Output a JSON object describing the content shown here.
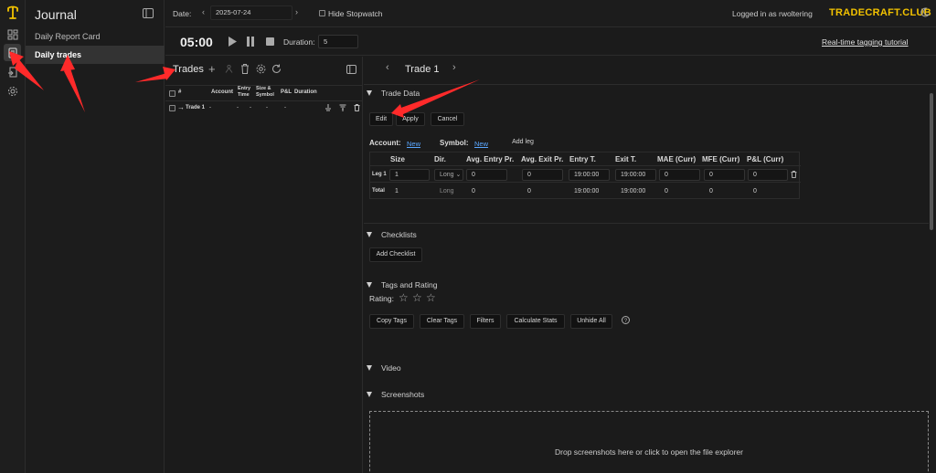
{
  "app": {
    "title": "Journal",
    "brand": "TRADECRAFT.CLUB",
    "logged_in": "Logged in as rwoltering"
  },
  "sidebar": {
    "items": [
      {
        "label": "Daily Report Card"
      },
      {
        "label": "Daily trades"
      }
    ]
  },
  "header": {
    "date_label": "Date:",
    "date_value": "2025-07-24",
    "hide_stopwatch": "Hide Stopwatch",
    "timer": "05:00",
    "duration_label": "Duration:",
    "duration_value": "5",
    "tutorial_link": "Real-time tagging tutorial"
  },
  "trades_panel": {
    "title": "Trades",
    "columns": [
      "#",
      "Account",
      "Entry Time",
      "Size & Symbol",
      "P&L",
      "Duration"
    ],
    "rows": [
      {
        "name": "Trade 1",
        "suffix": "-",
        "account": "-",
        "entry_time": "-",
        "size_symbol": "-",
        "pnl": "-"
      }
    ]
  },
  "trade_view": {
    "title": "Trade 1",
    "trade_data": {
      "heading": "Trade Data",
      "edit": "Edit",
      "apply": "Apply",
      "cancel": "Cancel",
      "account_label": "Account:",
      "account_new": "New",
      "symbol_label": "Symbol:",
      "symbol_new": "New",
      "add_leg": "Add leg",
      "headers": [
        "Size",
        "Dir.",
        "Avg. Entry Pr.",
        "Avg. Exit Pr.",
        "Entry T.",
        "Exit T.",
        "MAE (Curr)",
        "MFE (Curr)",
        "P&L (Curr)"
      ],
      "rows": [
        {
          "label": "Leg 1",
          "size": "1",
          "dir": "Long",
          "entry_pr": "0",
          "exit_pr": "0",
          "entry_t": "19:00:00",
          "exit_t": "19:00:00",
          "mae": "0",
          "mfe": "0",
          "pnl": "0"
        },
        {
          "label": "Total",
          "size": "1",
          "dir": "Long",
          "entry_pr": "0",
          "exit_pr": "0",
          "entry_t": "19:00:00",
          "exit_t": "19:00:00",
          "mae": "0",
          "mfe": "0",
          "pnl": "0"
        }
      ]
    },
    "checklists": {
      "heading": "Checklists",
      "add": "Add Checklist"
    },
    "tags": {
      "heading": "Tags and Rating",
      "rating_label": "Rating:",
      "rating_value": 0,
      "rating_max": 3,
      "buttons": [
        "Copy Tags",
        "Clear Tags",
        "Filters",
        "Calculate Stats",
        "Unhide All"
      ]
    },
    "video": {
      "heading": "Video"
    },
    "screenshots": {
      "heading": "Screenshots",
      "drop_text": "Drop screenshots here or click to open the file explorer"
    }
  },
  "colors": {
    "background": "#1b1b1b",
    "accent": "#f2c200",
    "link": "#5aa7ff",
    "annotation": "#ff2a2a"
  }
}
